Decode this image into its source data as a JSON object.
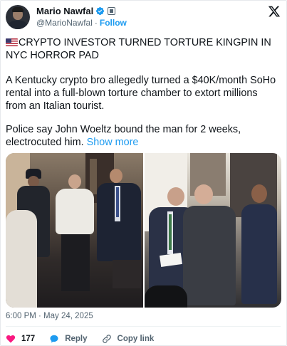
{
  "post": {
    "author": {
      "display_name": "Mario Nawfal",
      "handle": "@MarioNawfal",
      "separator": "·",
      "follow_label": "Follow"
    },
    "headline": "CRYPTO INVESTOR TURNED TORTURE KINGPIN IN NYC HORROR PAD",
    "paragraph_1": "A Kentucky crypto bro allegedly turned a $40K/month SoHo rental into a full-blown torture chamber to extort millions from an Italian tourist.",
    "paragraph_2": "Police say John Woeltz bound the man for 2 weeks, electrocuted him.",
    "show_more_label": "Show more",
    "timestamp": "6:00 PM · May 24, 2025",
    "actions": {
      "like_count": "177",
      "reply_label": "Reply",
      "copy_link_label": "Copy link"
    }
  },
  "icons": {
    "flag": "us-flag-emoji",
    "verified": "verified-badge-icon",
    "affiliation": "affiliation-badge-icon",
    "brand": "x-logo-icon",
    "like": "heart-icon",
    "reply": "speech-bubble-icon",
    "copy_link": "link-icon"
  },
  "colors": {
    "accent": "#1d9bf0",
    "like": "#f91880",
    "text": "#0f1419",
    "secondary_text": "#536471"
  }
}
